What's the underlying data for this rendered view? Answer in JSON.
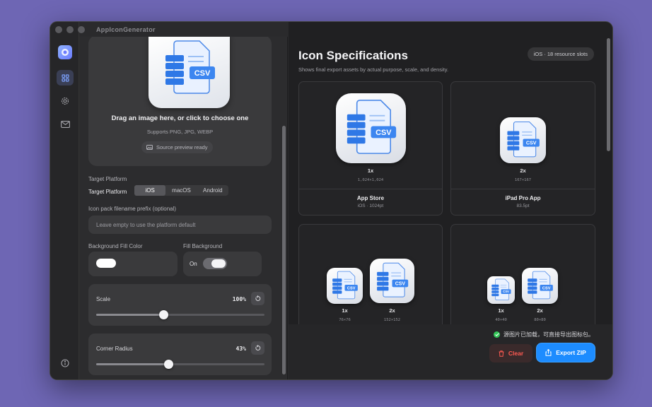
{
  "window": {
    "title": "AppIconGenerator"
  },
  "rail": {
    "items": [
      "grid-icon",
      "gear-icon",
      "mail-icon",
      "info-icon"
    ]
  },
  "upload": {
    "title": "Drag an image here, or click to choose one",
    "formats": "Supports PNG, JPG, WEBP",
    "status": "Source preview ready",
    "art_label": "CSV"
  },
  "platform": {
    "section_label": "Target Platform",
    "field_label": "Target Platform",
    "options": [
      "iOS",
      "macOS",
      "Android"
    ],
    "selected": "iOS"
  },
  "prefix": {
    "label": "Icon pack filename prefix (optional)",
    "placeholder": "Leave empty to use the platform default"
  },
  "background": {
    "fill_color_label": "Background Fill Color",
    "fill_color": "#ffffff",
    "fill_toggle_label": "Fill Background",
    "fill_toggle_state": "On"
  },
  "scale": {
    "label": "Scale",
    "value_text": "100%",
    "level": 0.4
  },
  "radius": {
    "label": "Corner Radius",
    "value_text": "43%",
    "level": 0.43
  },
  "specs": {
    "title": "Icon Specifications",
    "subtitle": "Shows final export assets by actual purpose, scale, and density.",
    "badge": "iOS · 18 resource slots",
    "cards": [
      {
        "variants": [
          {
            "scale": "1x",
            "size": "1,024×1,024"
          }
        ],
        "name": "App Store",
        "meta": "iOS · 1024pt"
      },
      {
        "variants": [
          {
            "scale": "2x",
            "size": "167×167"
          }
        ],
        "name": "iPad Pro App",
        "meta": "83.5pt"
      },
      {
        "variants": [
          {
            "scale": "1x",
            "size": "76×76"
          },
          {
            "scale": "2x",
            "size": "152×152"
          }
        ]
      },
      {
        "variants": [
          {
            "scale": "1x",
            "size": "40×40"
          },
          {
            "scale": "2x",
            "size": "80×80"
          }
        ]
      }
    ]
  },
  "footer": {
    "status": "源图片已加载，可直接导出图标包。",
    "clear_label": "Clear",
    "export_label": "Export ZIP"
  },
  "colors": {
    "accent": "#1d8cff",
    "danger": "#ff5a52",
    "success": "#34c759",
    "desktop": "#6e66b4"
  }
}
